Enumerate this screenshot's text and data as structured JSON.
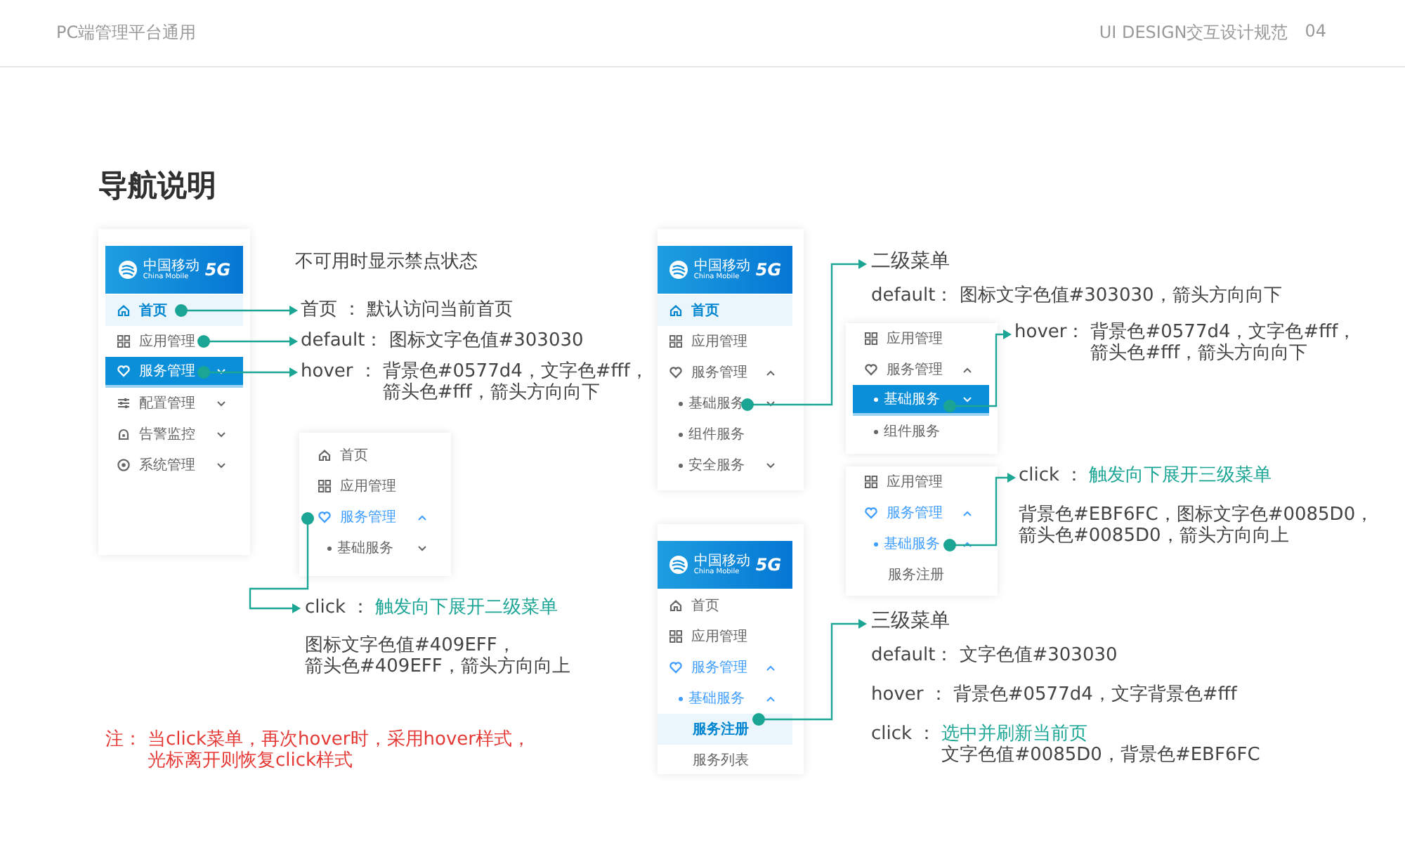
{
  "header": {
    "left": "PC端管理平台通用",
    "right": "UI DESIGN交互设计规范",
    "page": "04"
  },
  "title": "导航说明",
  "menus": [
    {
      "logo": {
        "name": "中国移动",
        "sub": "China Mobile",
        "badge": "5G"
      },
      "items": [
        {
          "kind": "home",
          "label": "首页",
          "selected": true,
          "hover": false,
          "active": false
        },
        {
          "kind": "apps",
          "label": "应用管理",
          "selected": false,
          "hover": false,
          "active": false
        },
        {
          "kind": "heart",
          "label": "服务管理",
          "selected": false,
          "hover": true,
          "active": false,
          "expanded": false
        },
        {
          "kind": "sliders",
          "label": "配置管理",
          "selected": false,
          "hover": false,
          "active": false,
          "expanded": false
        },
        {
          "kind": "alarm",
          "label": "告警监控",
          "selected": false,
          "hover": false,
          "active": false,
          "expanded": false
        },
        {
          "kind": "gear",
          "label": "系统管理",
          "selected": false,
          "hover": false,
          "active": false,
          "expanded": false
        }
      ]
    },
    {
      "items": [
        {
          "kind": "home",
          "label": "首页",
          "selected": false,
          "hover": false,
          "active": false
        },
        {
          "kind": "apps",
          "label": "应用管理",
          "selected": false,
          "hover": false,
          "active": false
        },
        {
          "kind": "heart",
          "label": "服务管理",
          "selected": false,
          "hover": false,
          "active": true,
          "expanded": true
        },
        {
          "kind": "sub",
          "label": "基础服务",
          "selected": false,
          "hover": false,
          "active": false,
          "expanded": false
        }
      ]
    },
    {
      "logo": {
        "name": "中国移动",
        "sub": "China Mobile",
        "badge": "5G"
      },
      "items": [
        {
          "kind": "home",
          "label": "首页",
          "selected": true,
          "hover": false,
          "active": false
        },
        {
          "kind": "apps",
          "label": "应用管理",
          "selected": false,
          "hover": false,
          "active": false
        },
        {
          "kind": "heart",
          "label": "服务管理",
          "selected": false,
          "hover": false,
          "active": false,
          "expanded": true
        },
        {
          "kind": "sub",
          "label": "基础服务",
          "selected": false,
          "hover": false,
          "active": false,
          "expanded": false
        },
        {
          "kind": "sub",
          "label": "组件服务",
          "selected": false,
          "hover": false,
          "active": false
        },
        {
          "kind": "sub",
          "label": "安全服务",
          "selected": false,
          "hover": false,
          "active": false,
          "expanded": false
        }
      ]
    },
    {
      "items": [
        {
          "kind": "apps",
          "label": "应用管理",
          "selected": false,
          "hover": false,
          "active": false
        },
        {
          "kind": "heart",
          "label": "服务管理",
          "selected": false,
          "hover": false,
          "active": false,
          "expanded": true
        },
        {
          "kind": "sub",
          "label": "基础服务",
          "selected": false,
          "hover": true,
          "active": false,
          "expanded": false
        },
        {
          "kind": "sub",
          "label": "组件服务",
          "selected": false,
          "hover": false,
          "active": false
        }
      ]
    },
    {
      "items": [
        {
          "kind": "apps",
          "label": "应用管理",
          "selected": false,
          "hover": false,
          "active": false
        },
        {
          "kind": "heart",
          "label": "服务管理",
          "selected": false,
          "hover": false,
          "active": true,
          "expanded": true
        },
        {
          "kind": "sub",
          "label": "基础服务",
          "selected": false,
          "hover": false,
          "active": true,
          "expanded": true
        },
        {
          "kind": "third",
          "label": "服务注册",
          "selected": false,
          "hover": false,
          "active": false
        }
      ]
    },
    {
      "logo": {
        "name": "中国移动",
        "sub": "China Mobile",
        "badge": "5G"
      },
      "items": [
        {
          "kind": "home",
          "label": "首页",
          "selected": false,
          "hover": false,
          "active": false
        },
        {
          "kind": "apps",
          "label": "应用管理",
          "selected": false,
          "hover": false,
          "active": false
        },
        {
          "kind": "heart",
          "label": "服务管理",
          "selected": false,
          "hover": false,
          "active": true,
          "expanded": true
        },
        {
          "kind": "sub",
          "label": "基础服务",
          "selected": false,
          "hover": false,
          "active": true,
          "expanded": true
        },
        {
          "kind": "third",
          "label": "服务注册",
          "selected": true,
          "hover": false,
          "active": false
        },
        {
          "kind": "third",
          "label": "服务列表",
          "selected": false,
          "hover": false,
          "active": false
        }
      ]
    }
  ],
  "notes": [
    {
      "kind": "caption",
      "lines": [
        {
          "text": "不可用时显示禁点状态",
          "accent": false
        }
      ]
    },
    {
      "kind": "term",
      "term": "首页 ：",
      "lines": [
        {
          "text": "默认访问当前首页",
          "accent": false
        }
      ]
    },
    {
      "kind": "term",
      "term": "default：",
      "lines": [
        {
          "text": "图标文字色值#303030",
          "accent": false
        }
      ]
    },
    {
      "kind": "term",
      "term": "hover ：",
      "lines": [
        {
          "text": "背景色#0577d4，文字色#fff，",
          "accent": false
        },
        {
          "text": "箭头色#fff，箭头方向向下",
          "accent": false
        }
      ]
    },
    {
      "kind": "term",
      "term": "click ：",
      "lines": [
        {
          "text": "触发向下展开二级菜单",
          "accent": true
        }
      ]
    },
    {
      "kind": "caption",
      "lines": [
        {
          "text": "图标文字色值#409EFF，",
          "accent": false
        },
        {
          "text": "箭头色#409EFF，箭头方向向上",
          "accent": false
        }
      ]
    },
    {
      "kind": "warning",
      "term": "注：",
      "lines": [
        {
          "text": "当click菜单，再次hover时，采用hover样式，",
          "accent": false
        },
        {
          "text": "光标离开则恢复click样式",
          "accent": false
        }
      ]
    },
    {
      "kind": "heading",
      "lines": [
        {
          "text": "二级菜单",
          "accent": false
        }
      ]
    },
    {
      "kind": "term",
      "term": "default：",
      "lines": [
        {
          "text": "图标文字色值#303030，箭头方向向下",
          "accent": false
        }
      ]
    },
    {
      "kind": "term",
      "term": "hover：",
      "lines": [
        {
          "text": "背景色#0577d4，文字色#fff，",
          "accent": false
        },
        {
          "text": "箭头色#fff，箭头方向向下",
          "accent": false
        }
      ]
    },
    {
      "kind": "term",
      "term": "click ：",
      "lines": [
        {
          "text": "触发向下展开三级菜单",
          "accent": true
        }
      ]
    },
    {
      "kind": "caption",
      "lines": [
        {
          "text": "背景色#EBF6FC，图标文字色#0085D0，",
          "accent": false
        },
        {
          "text": "箭头色#0085D0，箭头方向向上",
          "accent": false
        }
      ]
    },
    {
      "kind": "heading",
      "lines": [
        {
          "text": "三级菜单",
          "accent": false
        }
      ]
    },
    {
      "kind": "term",
      "term": "default：",
      "lines": [
        {
          "text": "文字色值#303030",
          "accent": false
        }
      ]
    },
    {
      "kind": "term",
      "term": "hover ：",
      "lines": [
        {
          "text": "背景色#0577d4，文字背景色#fff",
          "accent": false
        }
      ]
    },
    {
      "kind": "term",
      "term": "click ：",
      "lines": [
        {
          "text": "选中并刷新当前页",
          "accent": true
        },
        {
          "text": "文字色值#0085D0，背景色#EBF6FC",
          "accent": false
        }
      ]
    }
  ]
}
